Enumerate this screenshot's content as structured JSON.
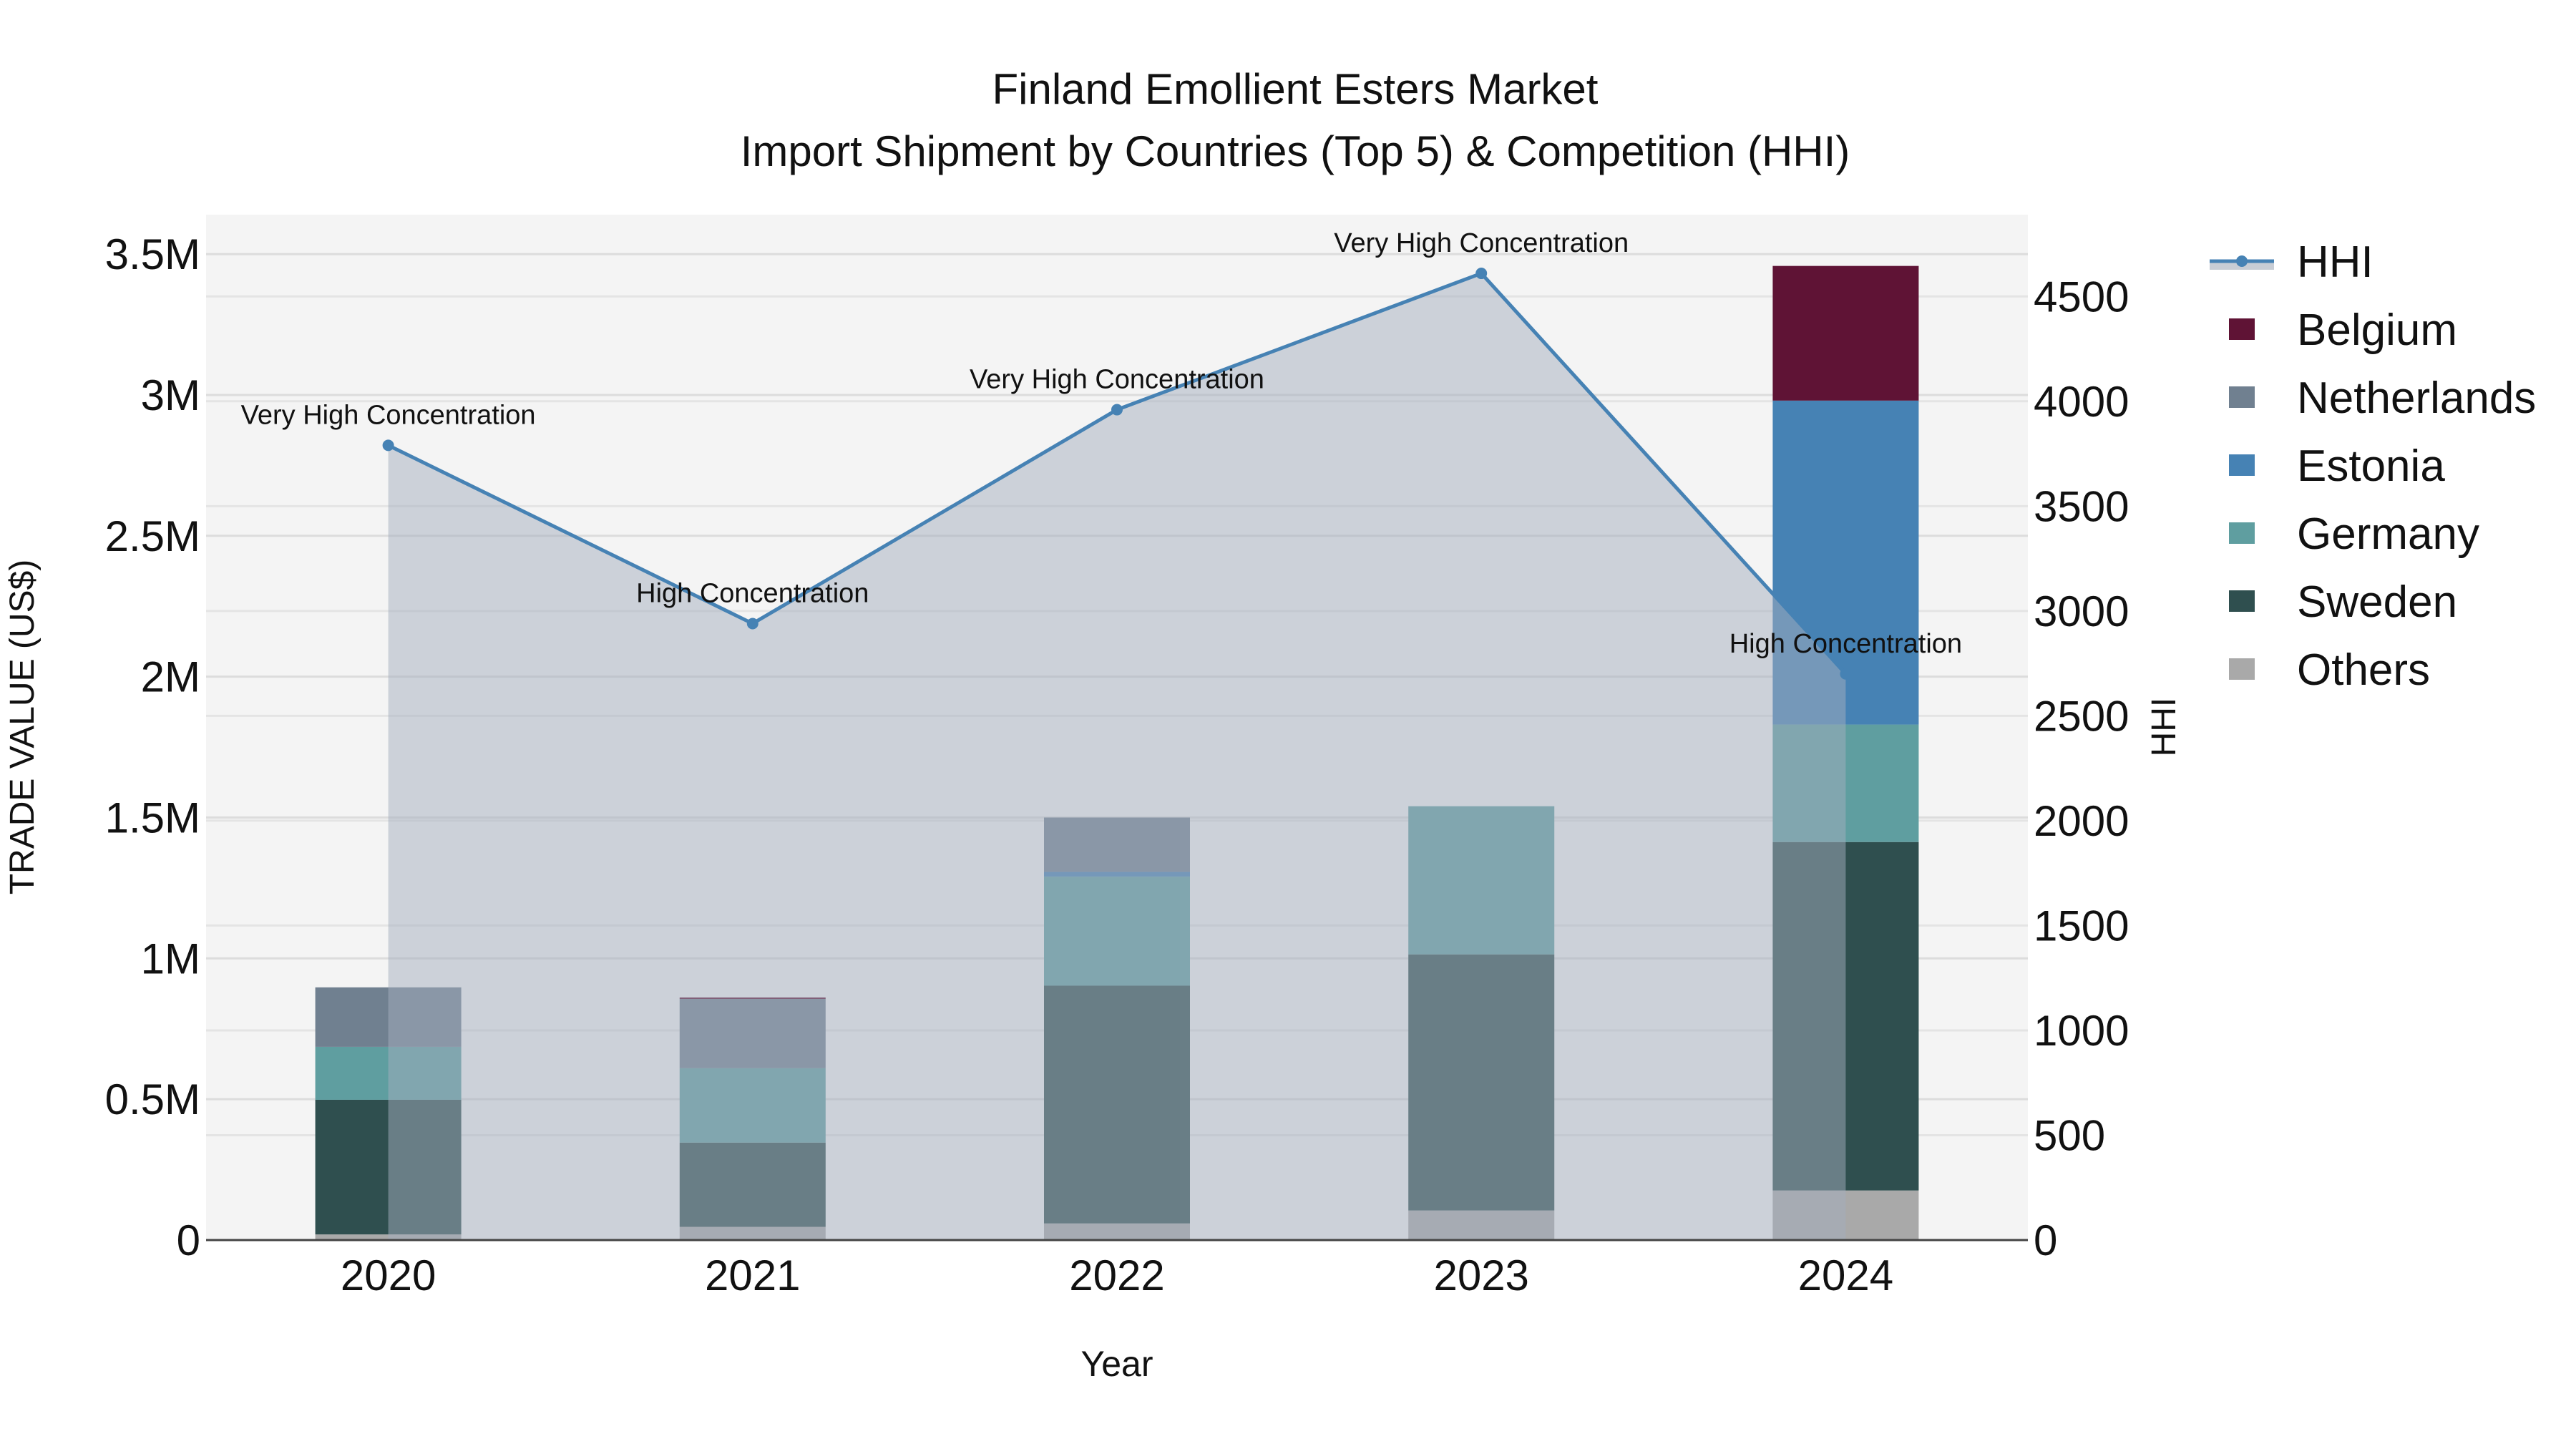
{
  "chart_data": {
    "type": "bar",
    "title": "Finland Emollient Esters Market",
    "subtitle": "Import Shipment by Countries (Top 5) & Competition (HHI)",
    "xlabel": "Year",
    "ylabel": "TRADE VALUE (US$)",
    "y2label": "HHI",
    "categories": [
      "2020",
      "2021",
      "2022",
      "2023",
      "2024"
    ],
    "ylim": [
      0,
      3640000
    ],
    "y2lim": [
      0,
      4890
    ],
    "yticks": [
      0,
      500000,
      1000000,
      1500000,
      2000000,
      2500000,
      3000000,
      3500000
    ],
    "ytick_labels": [
      "0",
      "0.5M",
      "1M",
      "1.5M",
      "2M",
      "2.5M",
      "3M",
      "3.5M"
    ],
    "y2ticks": [
      0,
      500,
      1000,
      1500,
      2000,
      2500,
      3000,
      3500,
      4000,
      4500
    ],
    "grid": true,
    "legend_position": "right",
    "series": [
      {
        "name": "Others",
        "color": "#a9a9a9",
        "values": [
          20000,
          47000,
          59000,
          105000,
          176000
        ]
      },
      {
        "name": "Sweden",
        "color": "#2f4f4f",
        "values": [
          478000,
          299000,
          844000,
          909000,
          1237000
        ]
      },
      {
        "name": "Germany",
        "color": "#5f9ea0",
        "values": [
          188000,
          264000,
          387000,
          526000,
          417000
        ]
      },
      {
        "name": "Estonia",
        "color": "#4682b4",
        "values": [
          0,
          0,
          17000,
          0,
          1150000
        ]
      },
      {
        "name": "Netherlands",
        "color": "#708090",
        "values": [
          211000,
          246000,
          193000,
          0,
          0
        ]
      },
      {
        "name": "Belgium",
        "color": "#5f1335",
        "values": [
          0,
          5000,
          0,
          0,
          478000
        ]
      }
    ],
    "hhi": {
      "name": "HHI",
      "color": "#4682b4",
      "values": [
        3790,
        2940,
        3960,
        4610,
        2700
      ],
      "annotations": [
        "Very High Concentration",
        "High Concentration",
        "Very High Concentration",
        "Very High Concentration",
        "High Concentration"
      ]
    },
    "legend_order": [
      "HHI",
      "Belgium",
      "Netherlands",
      "Estonia",
      "Germany",
      "Sweden",
      "Others"
    ]
  }
}
